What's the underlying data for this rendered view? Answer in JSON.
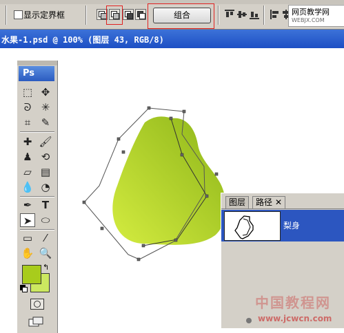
{
  "options_bar": {
    "show_bounding_box_label": "显示定界框",
    "combine_button": "组合",
    "watermark_site": "网页教学网",
    "watermark_url": "WEBJX.COM"
  },
  "document": {
    "title": "水果-1.psd @ 100% (图层 43, RGB/8)"
  },
  "toolbox": {
    "header": "Ps",
    "foreground_color": "#a8cc1c",
    "background_color": "#cce860"
  },
  "canvas": {
    "pear_gradient_light": "#d4ec40",
    "pear_gradient_dark": "#8cb418"
  },
  "paths_panel": {
    "tab_layers": "图层",
    "tab_paths": "路径",
    "path_name": "梨身"
  },
  "watermark_bottom": {
    "text": "中国教程网",
    "url": "www.jcwcn.com"
  }
}
